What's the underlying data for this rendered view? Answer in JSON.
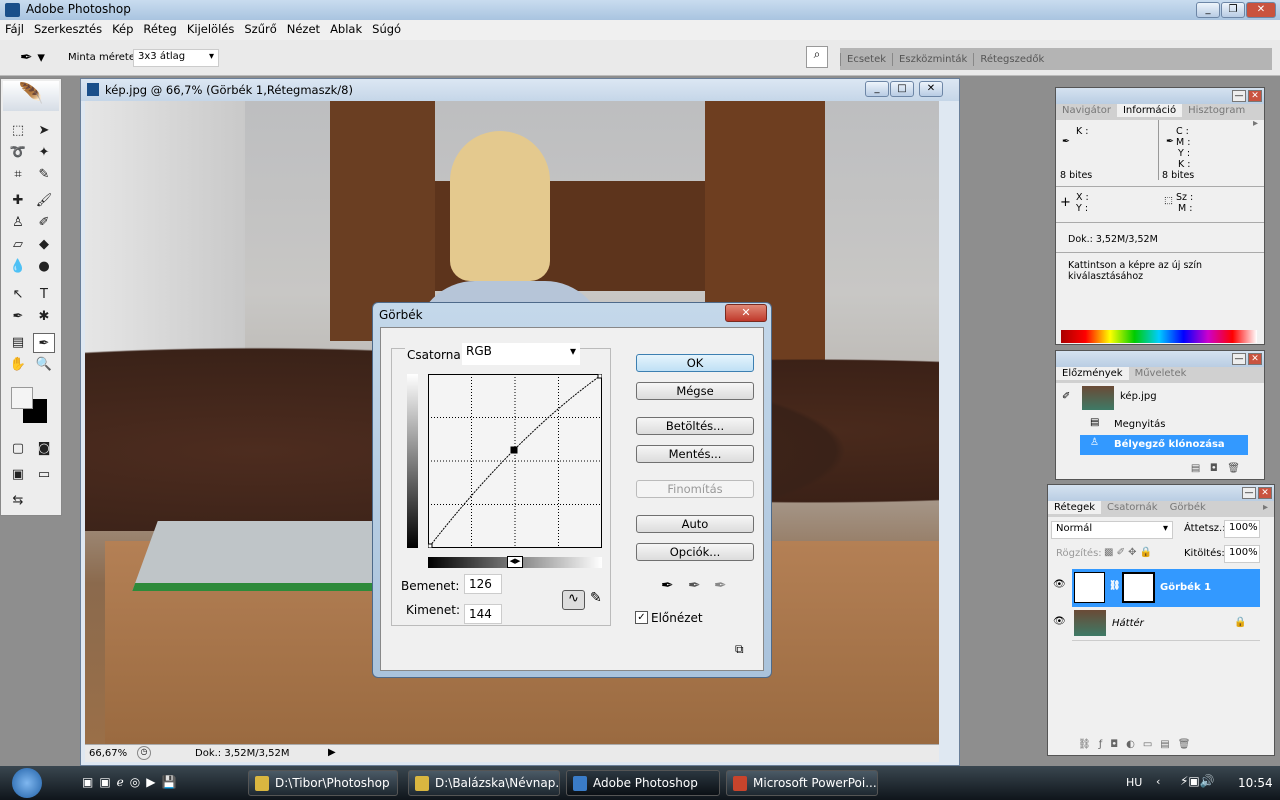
{
  "app": {
    "title": "Adobe Photoshop"
  },
  "menu": [
    "Fájl",
    "Szerkesztés",
    "Kép",
    "Réteg",
    "Kijelölés",
    "Szűrő",
    "Nézet",
    "Ablak",
    "Súgó"
  ],
  "options": {
    "sample_label": "Minta mérete:",
    "sample_value": "3x3 átlag"
  },
  "well_tabs": [
    "Ecsetek",
    "Eszközminták",
    "Rétegszedők"
  ],
  "document": {
    "title": "kép.jpg @ 66,7% (Görbék 1,Rétegmaszk/8)",
    "zoom": "66,67%",
    "doc_size": "Dok.: 3,52M/3,52M"
  },
  "curves": {
    "title": "Görbék",
    "channel_label": "Csatorna:",
    "channel": "RGB",
    "input_label": "Bemenet:",
    "input": "126",
    "output_label": "Kimenet:",
    "output": "144",
    "buttons": {
      "ok": "OK",
      "cancel": "Mégse",
      "load": "Betöltés...",
      "save": "Mentés...",
      "smooth": "Finomítás",
      "auto": "Auto",
      "options": "Opciók..."
    },
    "preview_label": "Előnézet",
    "preview_checked": true,
    "points": [
      [
        0,
        0
      ],
      [
        126,
        144
      ],
      [
        255,
        255
      ]
    ]
  },
  "info_panel": {
    "tabs": [
      "Navigátor",
      "Információ",
      "Hisztogram"
    ],
    "active": 1,
    "k": "K :",
    "cmyk": [
      "C :",
      "M :",
      "Y :",
      "K :"
    ],
    "bits_left": "8 bites",
    "bits_right": "8 bites",
    "x": "X :",
    "y": "Y :",
    "w": "Sz :",
    "h": "M :",
    "doc": "Dok.: 3,52M/3,52M",
    "hint": "Kattintson a képre az új szín kiválasztásához"
  },
  "history_panel": {
    "tabs": [
      "Előzmények",
      "Műveletek"
    ],
    "snapshot": "kép.jpg",
    "items": [
      {
        "label": "Megnyitás",
        "selected": false
      },
      {
        "label": "Bélyegző klónozása",
        "selected": true
      }
    ]
  },
  "layers_panel": {
    "tabs": [
      "Rétegek",
      "Csatornák",
      "Görbék"
    ],
    "blend": "Normál",
    "opacity_label": "Áttetsz.:",
    "opacity": "100%",
    "lock_label": "Rögzítés:",
    "fill_label": "Kitöltés:",
    "fill": "100%",
    "layers": [
      {
        "name": "Görbék 1",
        "selected": true,
        "visible": true
      },
      {
        "name": "Háttér",
        "selected": false,
        "visible": true,
        "locked": true
      }
    ]
  },
  "taskbar": {
    "tasks": [
      "D:\\Tibor\\Photoshop",
      "D:\\Balázska\\Névnap...",
      "Adobe Photoshop",
      "Microsoft PowerPoi..."
    ],
    "lang": "HU",
    "clock": "10:54"
  },
  "colors": {
    "selection": "#3399ff",
    "accent": "#1e6fd1"
  }
}
